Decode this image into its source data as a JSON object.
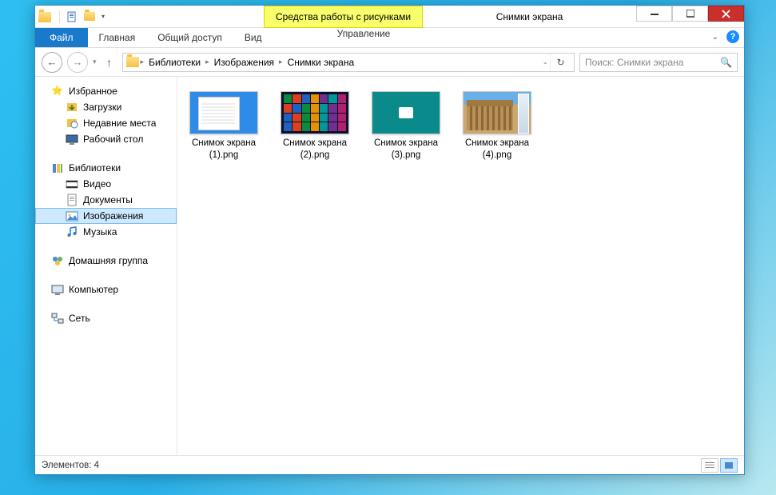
{
  "window": {
    "context_tab_title": "Средства работы с рисунками",
    "title": "Снимки экрана"
  },
  "ribbon": {
    "file": "Файл",
    "home": "Главная",
    "share": "Общий доступ",
    "view": "Вид",
    "manage": "Управление"
  },
  "address": {
    "seg1": "Библиотеки",
    "seg2": "Изображения",
    "seg3": "Снимки экрана"
  },
  "search": {
    "placeholder": "Поиск: Снимки экрана"
  },
  "tree": {
    "favorites": "Избранное",
    "downloads": "Загрузки",
    "recent": "Недавние места",
    "desktop": "Рабочий стол",
    "libraries": "Библиотеки",
    "video": "Видео",
    "documents": "Документы",
    "pictures": "Изображения",
    "music": "Музыка",
    "homegroup": "Домашняя группа",
    "computer": "Компьютер",
    "network": "Сеть"
  },
  "files": [
    {
      "name": "Снимок экрана (1).png"
    },
    {
      "name": "Снимок экрана (2).png"
    },
    {
      "name": "Снимок экрана (3).png"
    },
    {
      "name": "Снимок экрана (4).png"
    }
  ],
  "status": {
    "count_label": "Элементов: 4"
  },
  "tile_colors": [
    "#0a8a3a",
    "#d84020",
    "#2060c0",
    "#e89000",
    "#703090",
    "#009898",
    "#b02070",
    "#d84020",
    "#2060c0",
    "#0a8a3a",
    "#e89000",
    "#009898",
    "#703090",
    "#b02070",
    "#2060c0",
    "#d84020",
    "#0a8a3a",
    "#e89000",
    "#009898",
    "#703090",
    "#b02070",
    "#2060c0",
    "#d84020",
    "#0a8a3a",
    "#e89000",
    "#009898",
    "#703090",
    "#b02070"
  ]
}
